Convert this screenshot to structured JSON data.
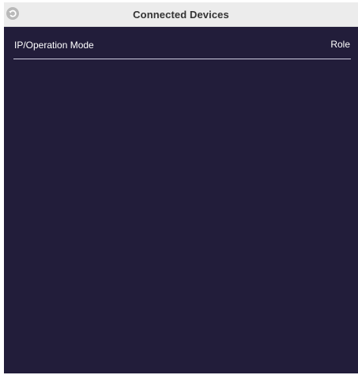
{
  "header": {
    "title": "Connected Devices",
    "back_icon": "back-icon"
  },
  "table": {
    "columns": [
      {
        "label": "IP/Operation Mode"
      },
      {
        "label": "Role"
      }
    ],
    "rows": []
  },
  "colors": {
    "background": "#221d3a",
    "titlebar": "#ececec",
    "text": "#ffffff"
  }
}
